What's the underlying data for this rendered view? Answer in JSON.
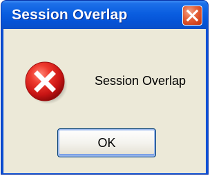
{
  "window": {
    "title": "Session Overlap"
  },
  "dialog": {
    "icon": "error-icon",
    "message": "Session Overlap",
    "ok_label": "OK"
  },
  "colors": {
    "titlebar": "#0553d6",
    "client_background": "#ece9d8",
    "close_button": "#d2431c",
    "error_icon": "#d81e1e"
  }
}
